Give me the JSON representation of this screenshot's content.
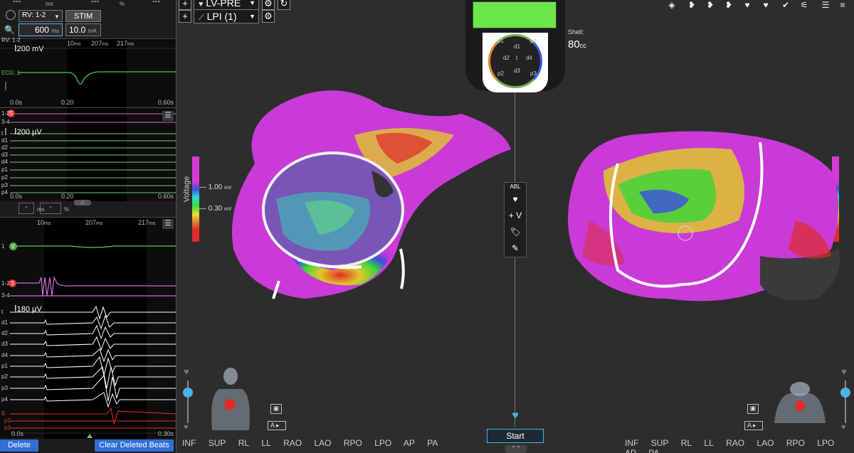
{
  "left": {
    "top_row": {
      "dashes1": "---",
      "ms": "ms",
      "dashes2": "---",
      "pct": "%"
    },
    "rv_select": "RV: 1-2",
    "stim_button": "STIM",
    "cycle_value": "600",
    "cycle_unit": "ms",
    "current_value": "10.0",
    "current_unit": "mA",
    "panel1": {
      "header": "RV: 1-2",
      "scale": "200 mV",
      "marker_10": "10",
      "marker_207": "207",
      "marker_217": "217",
      "ms": "ms",
      "ecg_label": "ECG: 1",
      "t0": "0.0s",
      "t1": "0.20",
      "t2": "0.60s"
    },
    "panel2": {
      "labels": [
        "1-2",
        "3-4",
        "t",
        "d1",
        "d2",
        "d3",
        "d4",
        "p1",
        "p2",
        "p3",
        "p4"
      ],
      "scale": "200 µV",
      "t0": "0.0s",
      "t1": "0.20",
      "t2": "0.60s"
    },
    "row3": {
      "dash1": "-",
      "ms": "ms",
      "dash2": "-",
      "pct": "%"
    },
    "panel3": {
      "marker_10": "10",
      "marker_207": "207",
      "marker_217": "217",
      "ms": "ms",
      "labels": [
        "1",
        "1-2",
        "3-4",
        "t",
        "d1",
        "d2",
        "d3",
        "d4",
        "p1",
        "p2",
        "p3",
        "p4",
        "B",
        "p3",
        "p3"
      ],
      "scale": "180 µV",
      "badge_v": "V",
      "badge_s": "S",
      "t0": "0.0s",
      "t2": "0.30s"
    },
    "delete_beat": "Delete Beat",
    "clear_deleted": "Clear Deleted Beats"
  },
  "main": {
    "map_select": "LV-PRE",
    "catheter_select": "LPI (1)",
    "plus": "+",
    "shell_label": "Shell:",
    "shell_value": "80",
    "shell_unit": "cc",
    "electrodes": [
      "p1",
      "p4",
      "d1",
      "d2",
      "t",
      "d4",
      "p2",
      "d3",
      "p3"
    ],
    "voltage_label": "Voltage",
    "v_high": "1.00",
    "v_low": "0.30",
    "v_unit": "mV",
    "center_tools": {
      "abl": "ABL",
      "plus_v": "+ V"
    },
    "start": "Start",
    "views_left": [
      "INF",
      "SUP",
      "RL",
      "LL",
      "RAO",
      "LAO",
      "RPO",
      "LPO",
      "AP",
      "PA"
    ],
    "views_right": [
      "INF",
      "SUP",
      "RL",
      "LL",
      "RAO",
      "LAO",
      "RPO",
      "LPO",
      "AP",
      "PA"
    ],
    "cam_label": "A"
  }
}
